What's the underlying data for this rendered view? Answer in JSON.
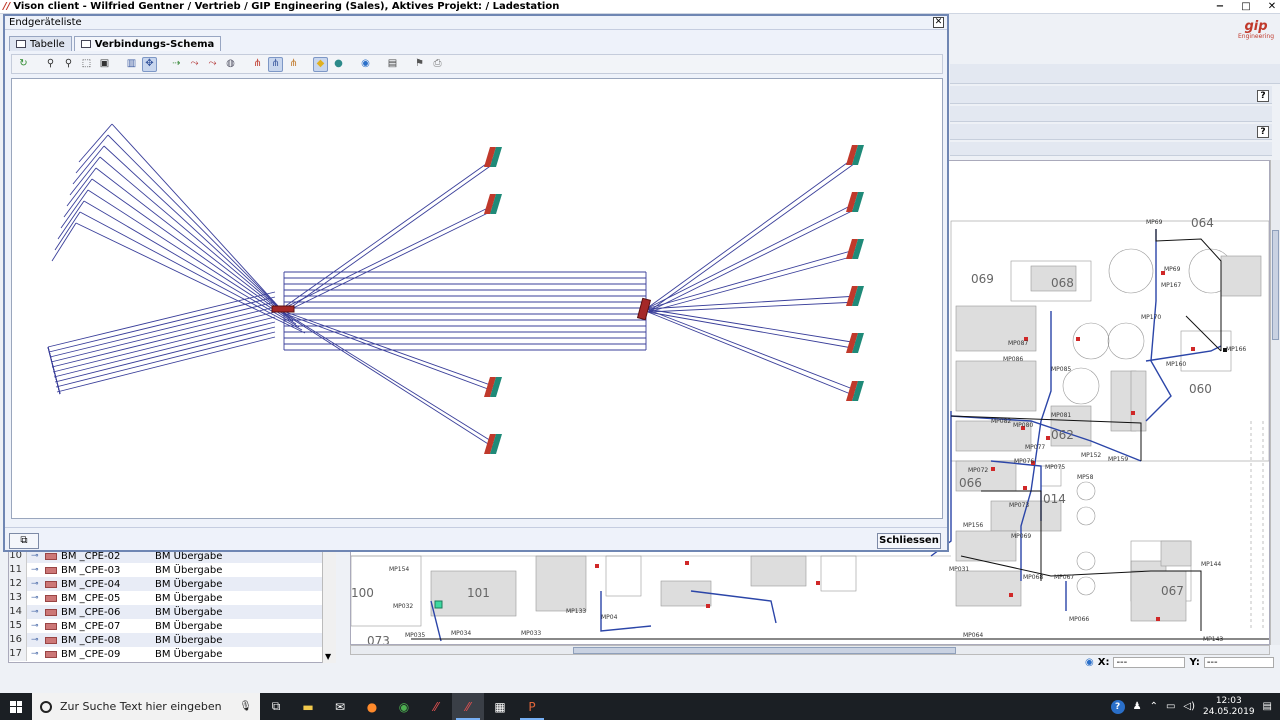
{
  "app": {
    "title": "Vison client - Wilfried Gentner / Vertrieb / GIP Engineering (Sales), Aktives Projekt:  / Ladestation",
    "logo_text": "gip",
    "logo_sub": "Engineering",
    "minimize": "−",
    "maximize": "□",
    "close": "✕"
  },
  "right_panel": {
    "help_label": "?"
  },
  "dialog": {
    "title": "Endgeräteliste",
    "close_symbol": "✕",
    "tabs": [
      {
        "label": "Tabelle",
        "active": false
      },
      {
        "label": "Verbindungs-Schema",
        "active": true
      }
    ],
    "toolbar_icons": [
      {
        "name": "refresh-icon",
        "glyph": "↻",
        "color": "#2d8a2d"
      },
      {
        "name": "zoom-in-icon",
        "glyph": "⚲",
        "color": "#333"
      },
      {
        "name": "zoom-out-icon",
        "glyph": "⚲",
        "color": "#333"
      },
      {
        "name": "zoom-window-icon",
        "glyph": "⬚",
        "color": "#333"
      },
      {
        "name": "zoom-fit-icon",
        "glyph": "▣",
        "color": "#333"
      },
      {
        "name": "layout-icon",
        "glyph": "▥",
        "color": "#3b5aa0"
      },
      {
        "name": "select-icon",
        "glyph": "✥",
        "color": "#3b5aa0"
      },
      {
        "name": "connect-icon",
        "glyph": "⇢",
        "color": "#3b8a3b"
      },
      {
        "name": "route-a-icon",
        "glyph": "⤳",
        "color": "#b03030"
      },
      {
        "name": "route-b-icon",
        "glyph": "⤳",
        "color": "#b03030"
      },
      {
        "name": "globe-icon",
        "glyph": "◍",
        "color": "#556"
      },
      {
        "name": "tree-icon",
        "glyph": "⋔",
        "color": "#c0392b"
      },
      {
        "name": "tree-selected-icon",
        "glyph": "⋔",
        "color": "#3b5aa0"
      },
      {
        "name": "tree-expand-icon",
        "glyph": "⋔",
        "color": "#c07a2b"
      },
      {
        "name": "highlight-icon",
        "glyph": "◆",
        "color": "#e0b020"
      },
      {
        "name": "color-icon",
        "glyph": "●",
        "color": "#2d8a8a"
      },
      {
        "name": "world-icon",
        "glyph": "◉",
        "color": "#2a6fc9"
      },
      {
        "name": "export-icon",
        "glyph": "▤",
        "color": "#444"
      },
      {
        "name": "pin-icon",
        "glyph": "⚑",
        "color": "#555"
      },
      {
        "name": "print-icon",
        "glyph": "⎙",
        "color": "#777"
      }
    ],
    "dock_symbol": "⧉",
    "close_button": "Schliessen"
  },
  "list": {
    "rows": [
      {
        "num": "10",
        "name": "BM _CPE-02",
        "type": "BM Übergabe"
      },
      {
        "num": "11",
        "name": "BM _CPE-03",
        "type": "BM Übergabe"
      },
      {
        "num": "12",
        "name": "BM _CPE-04",
        "type": "BM Übergabe"
      },
      {
        "num": "13",
        "name": "BM _CPE-05",
        "type": "BM Übergabe"
      },
      {
        "num": "14",
        "name": "BM _CPE-06",
        "type": "BM Übergabe"
      },
      {
        "num": "15",
        "name": "BM _CPE-07",
        "type": "BM Übergabe"
      },
      {
        "num": "16",
        "name": "BM _CPE-08",
        "type": "BM Übergabe"
      },
      {
        "num": "17",
        "name": "BM _CPE-09",
        "type": "BM Übergabe"
      }
    ]
  },
  "map": {
    "labels": [
      "064",
      "069",
      "068",
      "060",
      "062",
      "014",
      "067",
      "100",
      "101",
      "073",
      "066"
    ],
    "mp_labels": [
      "MP69",
      "MP167",
      "MP170",
      "MP166",
      "MP160",
      "MP087",
      "MP086",
      "MP085",
      "MP081",
      "MP082",
      "MP080",
      "MP077",
      "MP076",
      "MP075",
      "MP159",
      "MP58",
      "MP152",
      "MP072",
      "MP073",
      "MP071",
      "MP069",
      "MP156",
      "MP068",
      "MP067",
      "MP066",
      "MP144",
      "MP143",
      "MP064",
      "MP154",
      "MP032",
      "MP034",
      "MP033",
      "MP035",
      "MP133",
      "MP04",
      "MP031"
    ],
    "x_label": "X:",
    "x_value": "---",
    "y_label": "Y:",
    "y_value": "---"
  },
  "taskbar": {
    "search_placeholder": "Zur Suche Text hier eingeben",
    "time": "12:03",
    "date": "24.05.2019",
    "help": "?"
  },
  "colors": {
    "dialog_border": "#6f86b3",
    "schema_line": "#3a3f9a",
    "device_red": "#c0392b",
    "device_teal": "#1f8a78"
  }
}
